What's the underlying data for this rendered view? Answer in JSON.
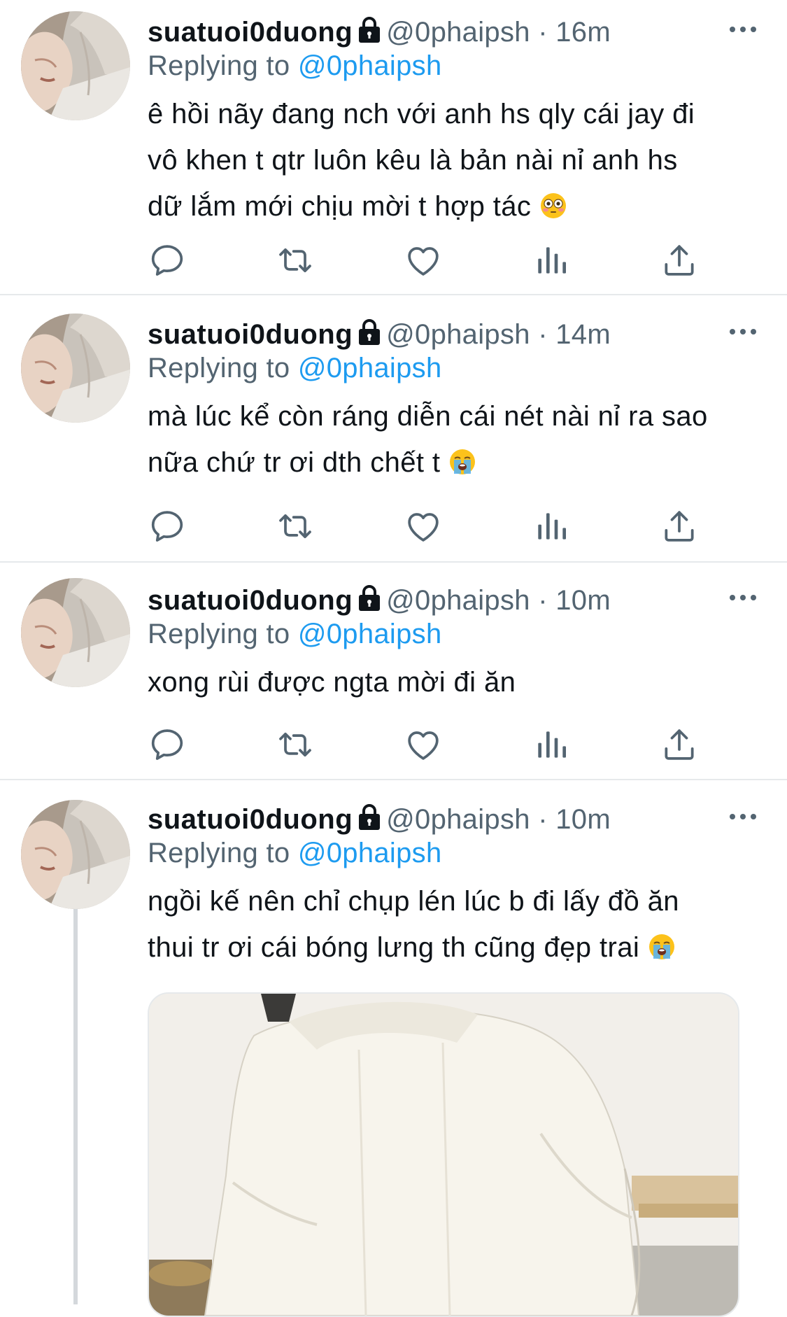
{
  "tweets": [
    {
      "display_name": "suatuoi0duong",
      "handle": "@0phaipsh",
      "time_sep": " · ",
      "time": "16m",
      "replying_label": "Replying to ",
      "replying_to": "@0phaipsh",
      "text_lines": [
        "ê hồi nãy đang nch với anh hs qly cái jay đi",
        "vô khen t qtr luôn kêu là bản nài nỉ anh hs",
        "dữ lắm mới chịu mời t hợp tác"
      ],
      "emoji": "flushed-face"
    },
    {
      "display_name": "suatuoi0duong",
      "handle": "@0phaipsh",
      "time_sep": " · ",
      "time": "14m",
      "replying_label": "Replying to ",
      "replying_to": "@0phaipsh",
      "text_lines": [
        "mà lúc kể còn ráng diễn cái nét nài nỉ ra sao",
        "nữa chứ tr ơi dth chết t"
      ],
      "emoji": "loudly-crying-face"
    },
    {
      "display_name": "suatuoi0duong",
      "handle": "@0phaipsh",
      "time_sep": " · ",
      "time": "10m",
      "replying_label": "Replying to ",
      "replying_to": "@0phaipsh",
      "text_lines": [
        "xong rùi được ngta mời đi ăn"
      ],
      "emoji": ""
    },
    {
      "display_name": "suatuoi0duong",
      "handle": "@0phaipsh",
      "time_sep": " · ",
      "time": "10m",
      "replying_label": "Replying to ",
      "replying_to": "@0phaipsh",
      "text_lines": [
        "ngồi kế nên chỉ chụp lén lúc b đi lấy đồ ăn",
        "thui tr ơi cái bóng lưng th cũng đẹp trai"
      ],
      "emoji": "loudly-crying-face",
      "media": "photo-of-man-in-white-shirt-from-behind"
    }
  ],
  "icons": {
    "reply": "reply-icon",
    "retweet": "retweet-icon",
    "like": "like-icon",
    "analytics": "analytics-icon",
    "share": "share-icon",
    "more": "more-icon",
    "lock": "lock-icon"
  },
  "colors": {
    "link": "#1d9bf0",
    "secondary_text": "#536471",
    "primary_text": "#0f1419",
    "divider": "#e6e9eb"
  }
}
